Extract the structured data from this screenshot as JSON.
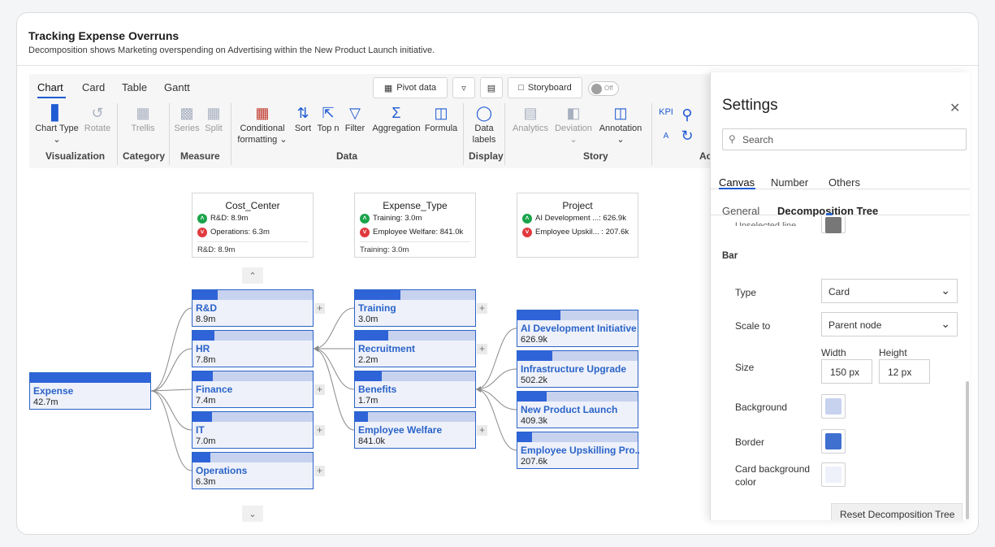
{
  "header": {
    "title": "Tracking Expense Overruns",
    "subtitle": "Decomposition shows Marketing overspending on Advertising within the New Product Launch initiative."
  },
  "ribbon": {
    "tabs": [
      "Chart",
      "Card",
      "Table",
      "Gantt"
    ],
    "pivot_label": "Pivot data",
    "storyboard_label": "Storyboard",
    "toggle_label": "Off",
    "buttons": {
      "chart_type": "Chart Type",
      "rotate": "Rotate",
      "trellis": "Trellis",
      "series": "Series",
      "split": "Split",
      "conditional": "Conditional",
      "formatting": "formatting",
      "sort": "Sort",
      "topn": "Top n",
      "filter": "Filter",
      "aggregation": "Aggregation",
      "formula": "Formula",
      "data": "Data",
      "labels": "labels",
      "analytics": "Analytics",
      "deviation": "Deviation",
      "annotation": "Annotation",
      "kpi": "KPI",
      "kpi_a": "A"
    },
    "groups": {
      "visualization": "Visualization",
      "category": "Category",
      "measure": "Measure",
      "data": "Data",
      "display": "Display",
      "story": "Story",
      "ac": "Ac"
    }
  },
  "header_cards": [
    {
      "title": "Cost_Center",
      "up": "R&D: 8.9m",
      "down": "Operations: 6.3m",
      "footer": "R&D: 8.9m"
    },
    {
      "title": "Expense_Type",
      "up": "Training: 3.0m",
      "down": "Employee Welfare: 841.0k",
      "footer": "Training: 3.0m"
    },
    {
      "title": "Project",
      "up": "AI Development ...: 626.9k",
      "down": "Employee Upskil... : 207.6k",
      "footer": ""
    }
  ],
  "tree": {
    "root": {
      "name": "Expense",
      "value": "42.7m",
      "fill": 1.0
    },
    "level1": [
      {
        "name": "R&D",
        "value": "8.9m",
        "fill": 0.21
      },
      {
        "name": "HR",
        "value": "7.8m",
        "fill": 0.18
      },
      {
        "name": "Finance",
        "value": "7.4m",
        "fill": 0.17
      },
      {
        "name": "IT",
        "value": "7.0m",
        "fill": 0.16
      },
      {
        "name": "Operations",
        "value": "6.3m",
        "fill": 0.15
      }
    ],
    "level2": [
      {
        "name": "Training",
        "value": "3.0m",
        "fill": 0.38
      },
      {
        "name": "Recruitment",
        "value": "2.2m",
        "fill": 0.28
      },
      {
        "name": "Benefits",
        "value": "1.7m",
        "fill": 0.22
      },
      {
        "name": "Employee Welfare",
        "value": "841.0k",
        "fill": 0.11
      }
    ],
    "level3": [
      {
        "name": "AI Development Initiative",
        "value": "626.9k",
        "fill": 0.36
      },
      {
        "name": "Infrastructure Upgrade",
        "value": "502.2k",
        "fill": 0.29
      },
      {
        "name": "New Product Launch",
        "value": "409.3k",
        "fill": 0.24
      },
      {
        "name": "Employee Upskilling Pro...",
        "value": "207.6k",
        "fill": 0.12
      }
    ]
  },
  "settings": {
    "title": "Settings",
    "search_placeholder": "Search",
    "tabs": [
      "Canvas",
      "Number",
      "Others"
    ],
    "subtabs": [
      "General",
      "Decomposition Tree"
    ],
    "cut_text": "Unselected line",
    "section": "Bar",
    "type_label": "Type",
    "type_value": "Card",
    "scale_label": "Scale to",
    "scale_value": "Parent node",
    "size_label": "Size",
    "width_label": "Width",
    "height_label": "Height",
    "width_value": "150 px",
    "height_value": "12 px",
    "background_label": "Background",
    "border_label": "Border",
    "card_bg_label_1": "Card background",
    "card_bg_label_2": "color",
    "colors": {
      "background": "#c6d2ee",
      "border": "#3f6fcf",
      "card_background": "#eef1fa",
      "accent": "#1f5bd3"
    },
    "reset_label": "Reset Decomposition Tree"
  }
}
